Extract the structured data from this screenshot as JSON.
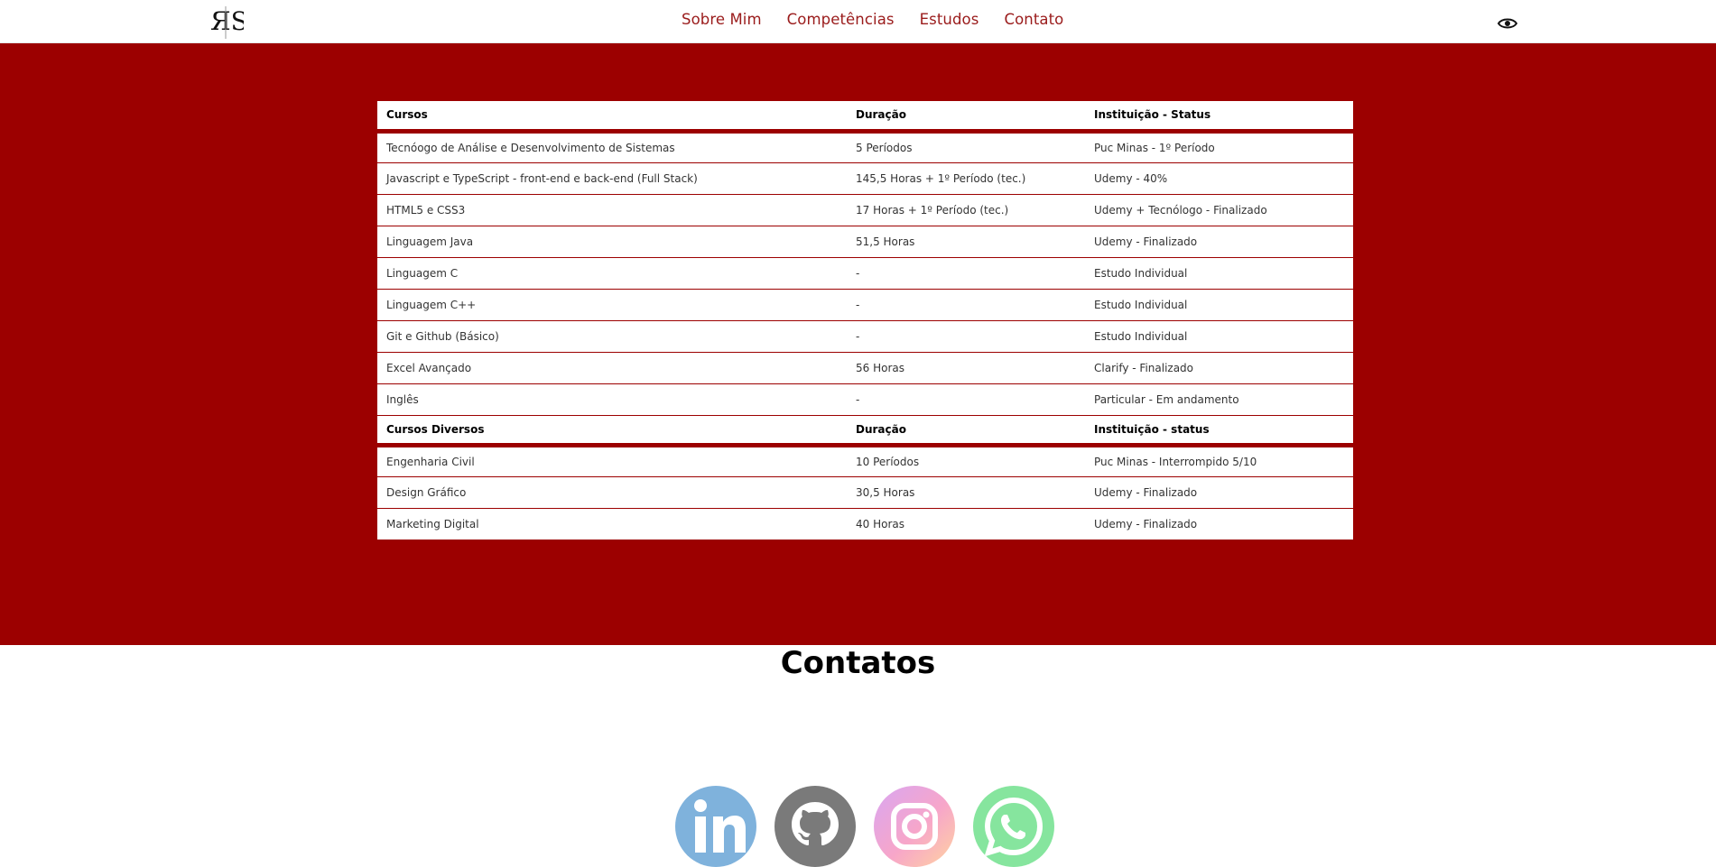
{
  "header": {
    "logo_text": "ЯS",
    "nav": [
      "Sobre Mim",
      "Competências",
      "Estudos",
      "Contato"
    ]
  },
  "table1": {
    "headers": [
      "Cursos",
      "Duração",
      "Instituição - Status"
    ],
    "rows": [
      [
        "Tecnóogo de Análise e Desenvolvimento de Sistemas",
        "5 Períodos",
        "Puc Minas - 1º Período"
      ],
      [
        "Javascript e TypeScript - front-end e back-end (Full Stack)",
        "145,5 Horas + 1º Período (tec.)",
        "Udemy - 40%"
      ],
      [
        "HTML5 e CSS3",
        "17 Horas + 1º Período (tec.)",
        "Udemy + Tecnólogo - Finalizado"
      ],
      [
        "Linguagem Java",
        "51,5 Horas",
        "Udemy - Finalizado"
      ],
      [
        "Linguagem C",
        "-",
        "Estudo Individual"
      ],
      [
        "Linguagem C++",
        "-",
        "Estudo Individual"
      ],
      [
        "Git e Github (Básico)",
        "-",
        "Estudo Individual"
      ],
      [
        "Excel Avançado",
        "56 Horas",
        "Clarify - Finalizado"
      ],
      [
        "Inglês",
        "-",
        "Particular - Em andamento"
      ]
    ]
  },
  "table2": {
    "headers": [
      "Cursos Diversos",
      "Duração",
      "Instituição - status"
    ],
    "rows": [
      [
        "Engenharia Civil",
        "10 Períodos",
        "Puc Minas - Interrompido 5/10"
      ],
      [
        "Design Gráfico",
        "30,5 Horas",
        "Udemy - Finalizado"
      ],
      [
        "Marketing Digital",
        "40 Horas",
        "Udemy - Finalizado"
      ]
    ]
  },
  "contacts": {
    "title": "Contatos",
    "icons": [
      "linkedin-icon",
      "github-icon",
      "instagram-icon",
      "whatsapp-icon"
    ]
  },
  "colors": {
    "accent": "#9c0000",
    "nav_text": "#9a1b1b",
    "linkedin": "#7fb2dc",
    "github": "#7a7a7a",
    "instagram_from": "#f7a6c9",
    "instagram_to": "#d9a6f2",
    "whatsapp": "#86e59e"
  }
}
